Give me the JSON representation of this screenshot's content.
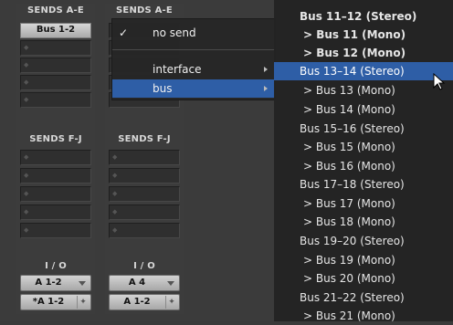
{
  "strip1": {
    "sends_ae_label": "SENDS A-E",
    "send_a": "Bus 1-2",
    "sends_fj_label": "SENDS F-J",
    "io_label": "I / O",
    "input": "A 1-2",
    "output": "*A 1-2"
  },
  "strip2": {
    "sends_ae_label": "SENDS A-E",
    "sends_fj_label": "SENDS F-J",
    "io_label": "I / O",
    "input": "A 4",
    "output": "A 1-2"
  },
  "menu": {
    "no_send": "no send",
    "check": "✓",
    "interface": "interface",
    "bus": "bus"
  },
  "submenu": {
    "items": [
      {
        "label": "Bus 11–12 (Stereo)"
      },
      {
        "label": "> Bus 11 (Mono)"
      },
      {
        "label": "> Bus 12 (Mono)"
      },
      {
        "label": "Bus 13–14 (Stereo)"
      },
      {
        "label": "> Bus 13 (Mono)"
      },
      {
        "label": "> Bus 14 (Mono)"
      },
      {
        "label": "Bus 15–16 (Stereo)"
      },
      {
        "label": "> Bus 15 (Mono)"
      },
      {
        "label": "> Bus 16 (Mono)"
      },
      {
        "label": "Bus 17–18 (Stereo)"
      },
      {
        "label": "> Bus 17 (Mono)"
      },
      {
        "label": "> Bus 18 (Mono)"
      },
      {
        "label": "Bus 19–20 (Stereo)"
      },
      {
        "label": "> Bus 19 (Mono)"
      },
      {
        "label": "> Bus 20 (Mono)"
      },
      {
        "label": "Bus 21–22 (Stereo)"
      },
      {
        "label": "> Bus 21 (Mono)"
      }
    ]
  }
}
